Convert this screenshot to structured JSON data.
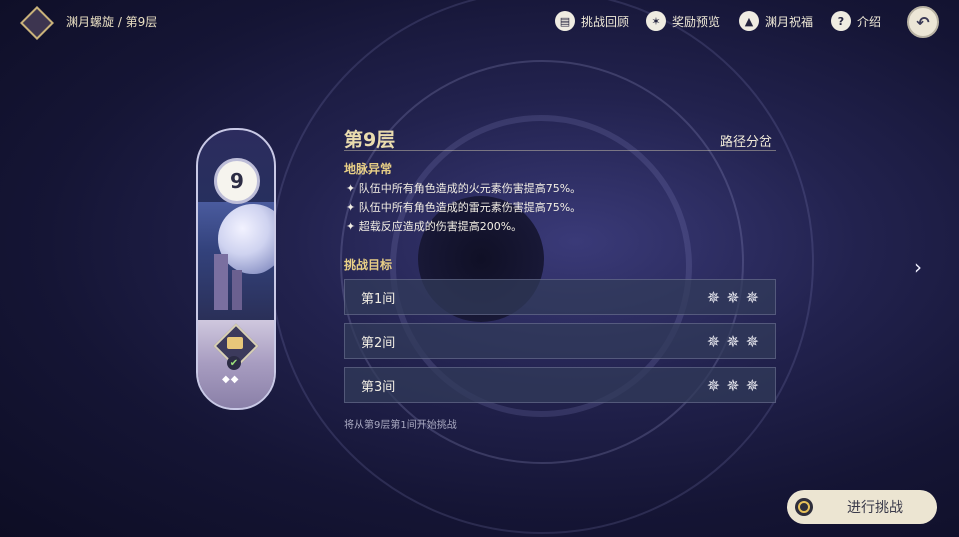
{
  "header": {
    "breadcrumb": "渊月螺旋 / 第9层",
    "nav": [
      {
        "label": "挑战回顾",
        "icon": "book-icon"
      },
      {
        "label": "奖励预览",
        "icon": "star-icon"
      },
      {
        "label": "渊月祝福",
        "icon": "blessing-icon"
      },
      {
        "label": "介绍",
        "icon": "question-icon"
      }
    ],
    "back_icon": "back-arrow-icon"
  },
  "floor_card": {
    "number": "9",
    "dots": "◆◆"
  },
  "panel": {
    "title": "第9层",
    "route": "路径分岔",
    "ley_label": "地脉异常",
    "buffs": [
      "✦ 队伍中所有角色造成的火元素伤害提高75%。",
      "✦ 队伍中所有角色造成的雷元素伤害提高75%。",
      "✦ 超载反应造成的伤害提高200%。"
    ],
    "objective_label": "挑战目标",
    "rooms": [
      {
        "name": "第1间",
        "stars": 3
      },
      {
        "name": "第2间",
        "stars": 3
      },
      {
        "name": "第3间",
        "stars": 3
      }
    ],
    "hint": "将从第9层第1间开始挑战"
  },
  "start_button": {
    "label": "进行挑战"
  },
  "colors": {
    "accent": "#e8cf86",
    "title": "#eadcae",
    "button_bg": "#ece5d2"
  }
}
